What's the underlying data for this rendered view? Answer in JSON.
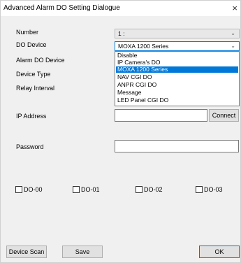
{
  "window": {
    "title": "Advanced Alarm DO Setting Dialogue",
    "close_glyph": "×"
  },
  "form": {
    "number_label": "Number",
    "number_value": "1 :",
    "do_device_label": "DO Device",
    "do_device_value": "MOXA 1200 Series",
    "alarm_do_device_label": "Alarm DO Device",
    "device_type_label": "Device Type",
    "relay_interval_label": "Relay Interval",
    "dropdown_options": [
      "Disable",
      "IP Camera's DO",
      "MOXA 1200 Series",
      "NAV CGI DO",
      "ANPR CGI DO",
      "Message",
      "LED Panel CGI DO"
    ],
    "dropdown_selected_index": 2,
    "ip_address_label": "IP Address",
    "ip_address_value": "",
    "connect_label": "Connect",
    "password_label": "Password",
    "password_value": ""
  },
  "do_checkboxes": [
    {
      "label": "DO-00",
      "checked": false
    },
    {
      "label": "DO-01",
      "checked": false
    },
    {
      "label": "DO-02",
      "checked": false
    },
    {
      "label": "DO-03",
      "checked": false
    }
  ],
  "footer": {
    "device_scan_label": "Device Scan",
    "save_label": "Save",
    "ok_label": "OK"
  },
  "icons": {
    "chevron": "chevron-down-icon",
    "close": "close-icon"
  }
}
